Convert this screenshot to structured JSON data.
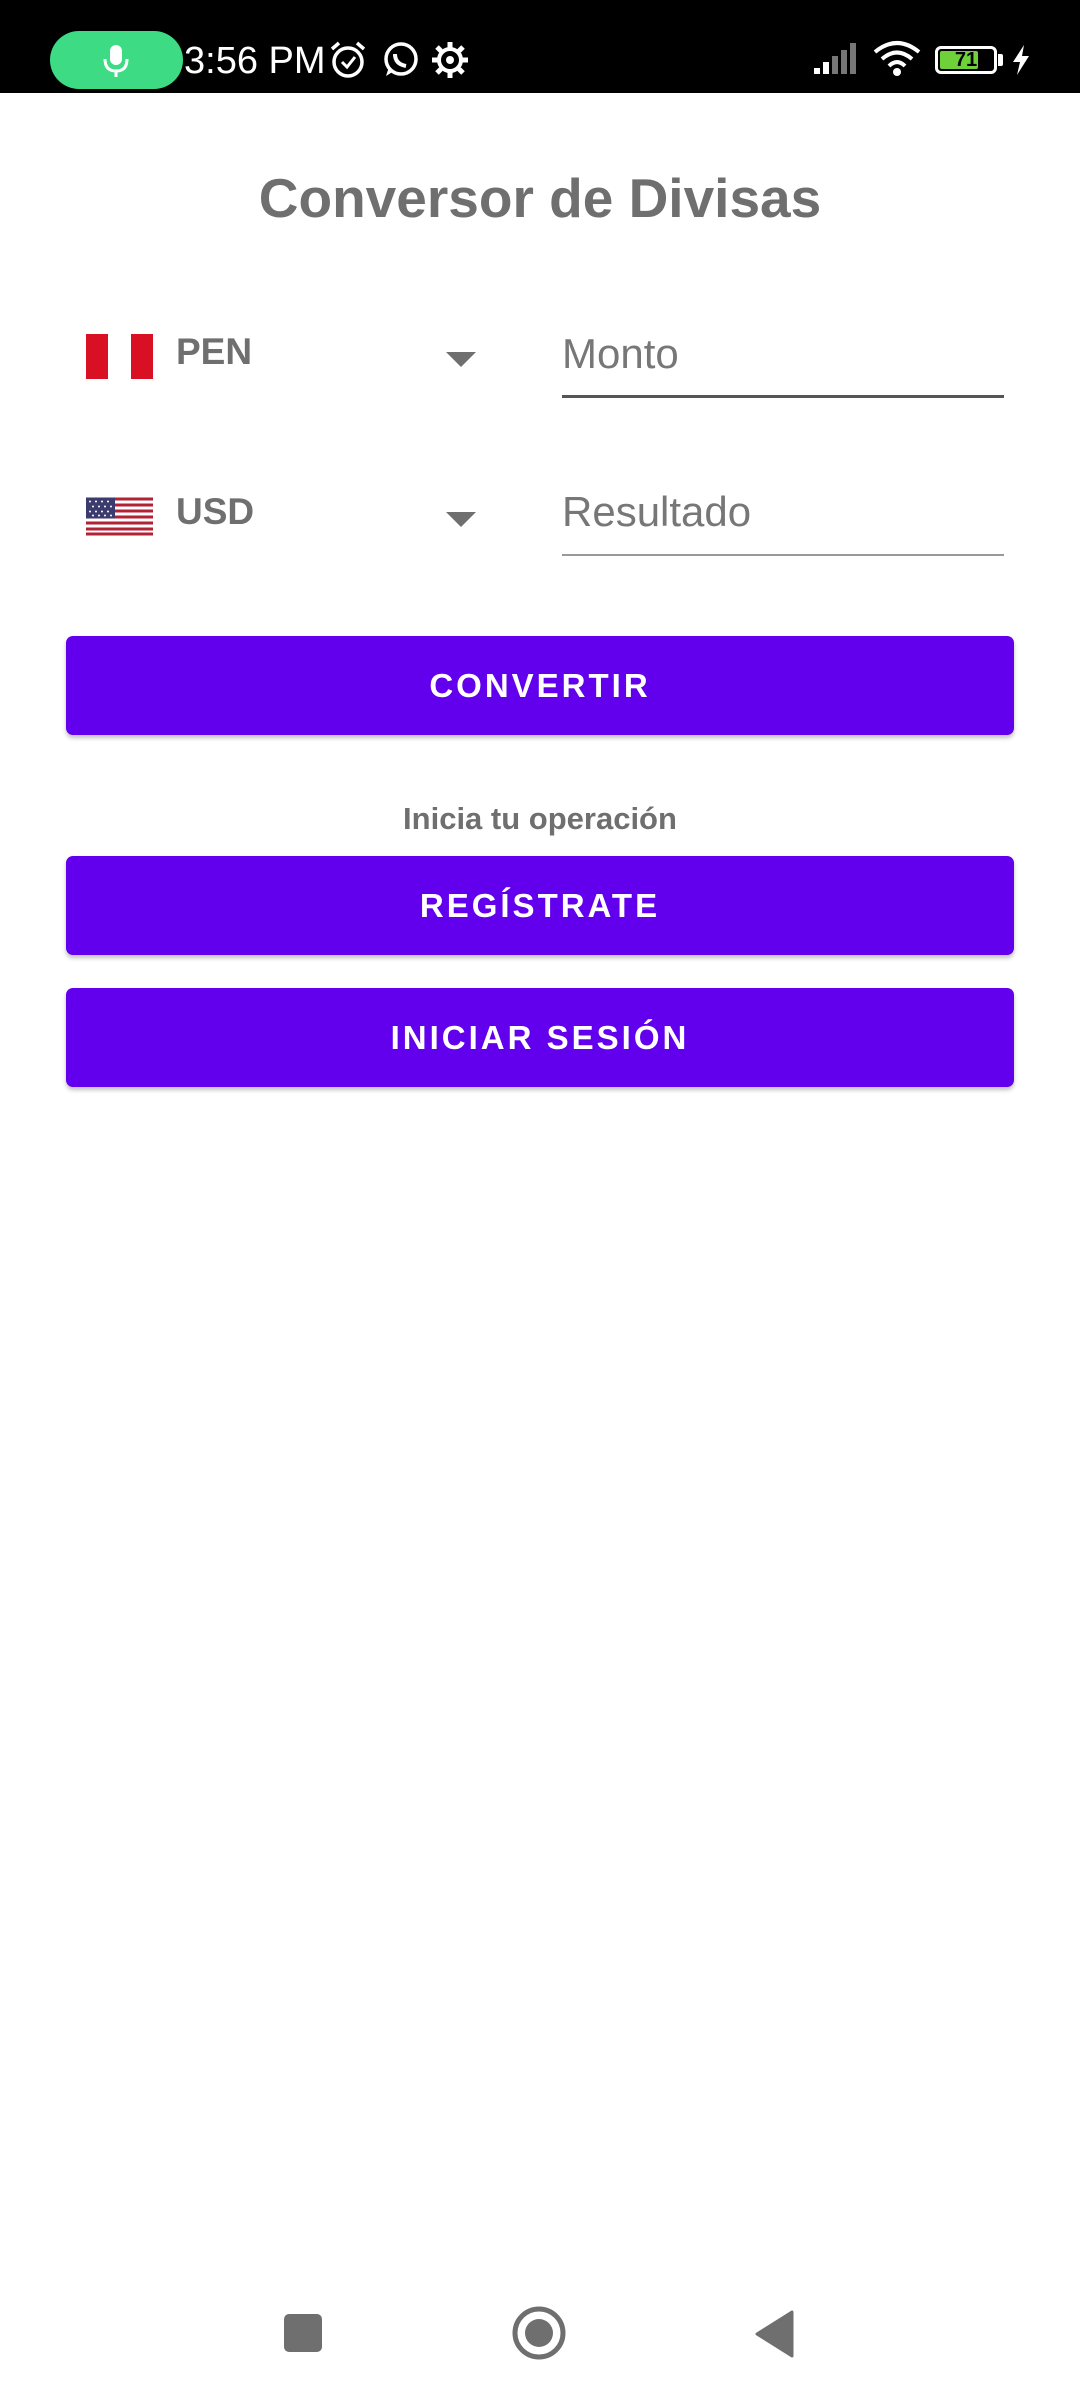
{
  "status_bar": {
    "time": "3:56 PM",
    "battery_level": "71",
    "icons": [
      "mic-icon",
      "alarm-icon",
      "whatsapp-icon",
      "settings-gear-icon",
      "signal-icon",
      "wifi-icon",
      "battery-icon",
      "charging-bolt-icon"
    ],
    "mic_pill_color": "#3ddc84"
  },
  "app": {
    "title": "Conversor de Divisas"
  },
  "converter": {
    "from_currency": {
      "code": "PEN",
      "flag": "peru-flag-icon"
    },
    "to_currency": {
      "code": "USD",
      "flag": "usa-flag-icon"
    },
    "amount_field": {
      "placeholder": "Monto",
      "value": ""
    },
    "result_field": {
      "placeholder": "Resultado",
      "value": ""
    },
    "convert_label": "CONVERTIR"
  },
  "auth": {
    "hint": "Inicia tu operación",
    "register_label": "REGÍSTRATE",
    "login_label": "INICIAR SESIÓN"
  },
  "colors": {
    "primary": "#6200ee",
    "text_gray": "#6f6f6f"
  },
  "nav_bar": {
    "icons": [
      "recents-square-icon",
      "home-circle-icon",
      "back-triangle-icon"
    ]
  }
}
